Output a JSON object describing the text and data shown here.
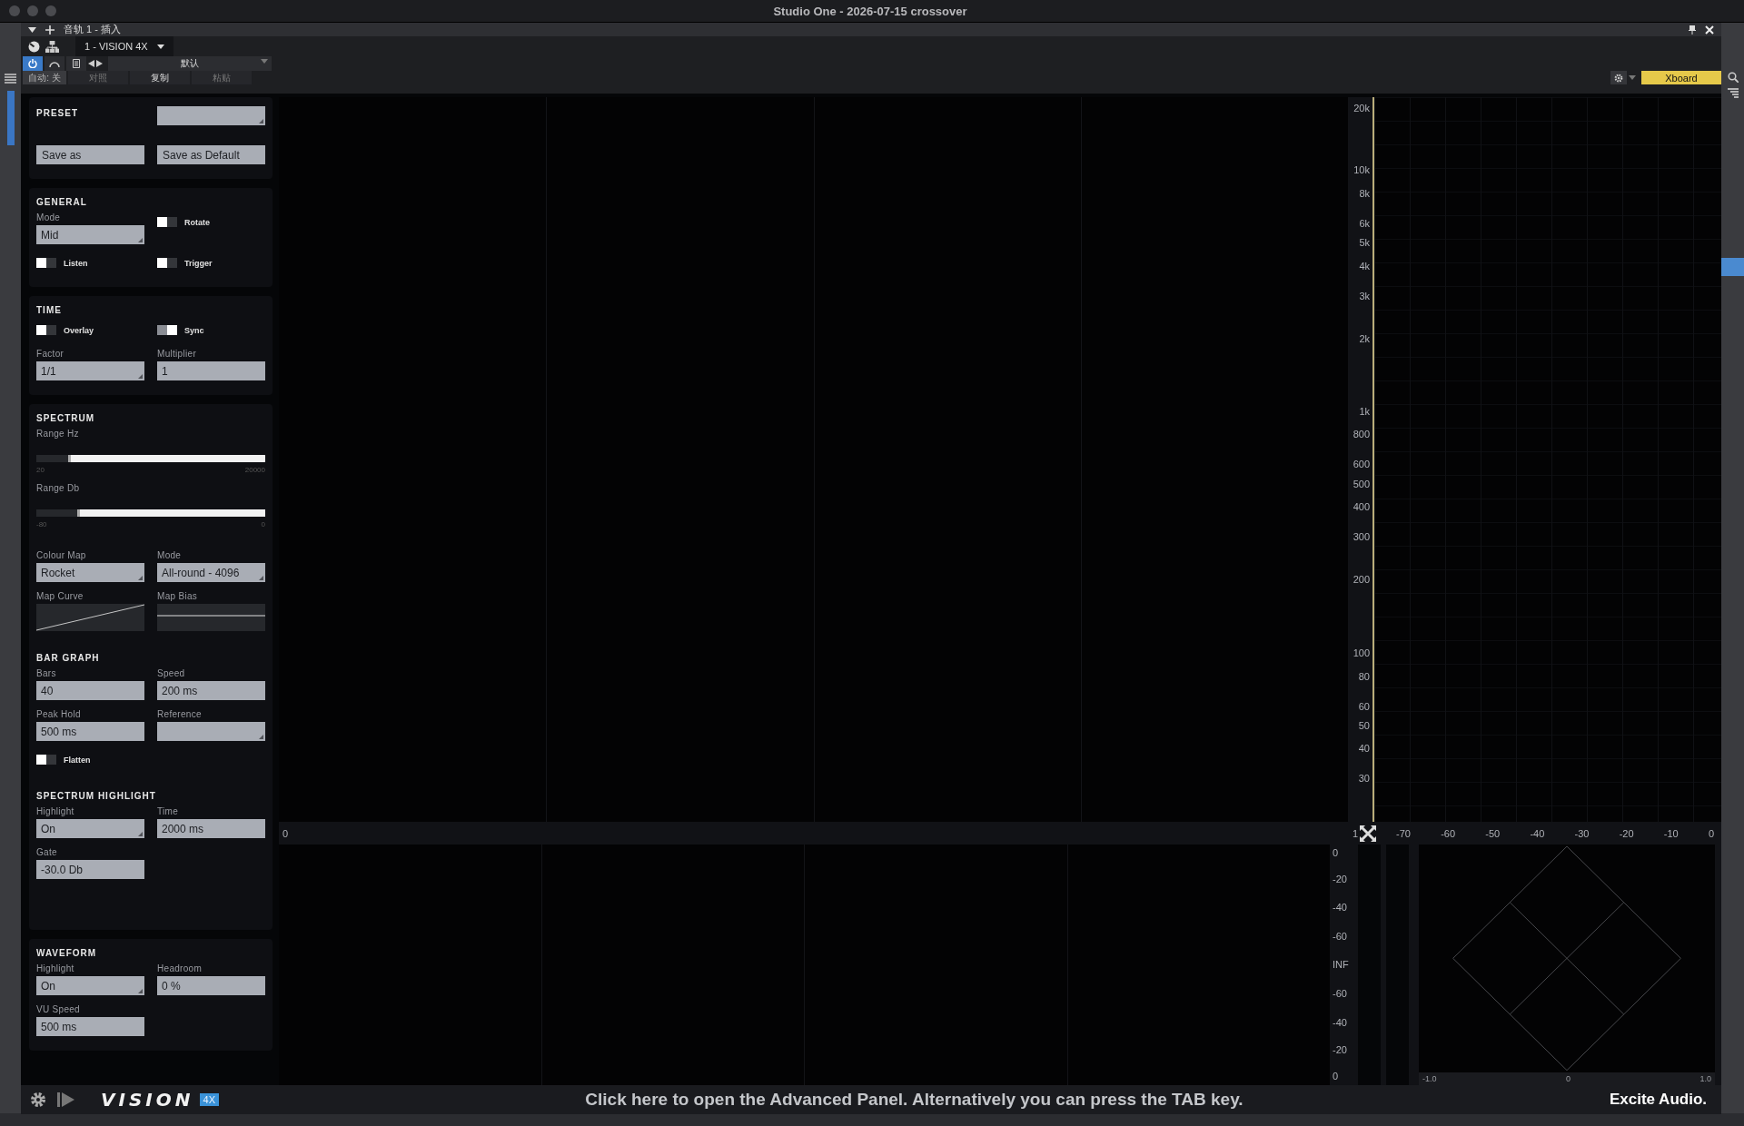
{
  "window": {
    "title": "Studio One - 2026-07-15 crossover"
  },
  "plugin_header": {
    "track": "音轨 1 - 插入",
    "plugin": "1 - VISION 4X",
    "preset": "默认",
    "power_on": true,
    "auto": "自动: 关",
    "compare": "对照",
    "copy": "复制",
    "paste": "粘贴",
    "xboard": "Xboard"
  },
  "cards": [
    {
      "groups": [
        {
          "items": [
            {
              "kind": "heading",
              "text": "PRESET"
            },
            {
              "kind": "field",
              "dropdown": true
            },
            {
              "kind": "button",
              "text": "Save as"
            },
            {
              "kind": "button",
              "text": "Save as Default"
            }
          ]
        }
      ]
    },
    {
      "groups": [
        {
          "title": "GENERAL",
          "items": [
            {
              "kind": "field",
              "label": "Mode",
              "value": "Mid",
              "dropdown": true
            },
            {
              "kind": "toggle",
              "label": "Rotate",
              "checked": false
            },
            {
              "kind": "toggle",
              "label": "Listen",
              "checked": false
            },
            {
              "kind": "toggle",
              "label": "Trigger",
              "checked": false
            }
          ]
        }
      ]
    },
    {
      "groups": [
        {
          "title": "TIME",
          "items": [
            {
              "kind": "toggle",
              "label": "Overlay",
              "checked": false
            },
            {
              "kind": "toggle",
              "label": "Sync",
              "checked": true
            },
            {
              "kind": "field",
              "label": "Factor",
              "value": "1/1",
              "dropdown": true
            },
            {
              "kind": "field",
              "label": "Multiplier",
              "value": "1",
              "dropdown": false
            }
          ]
        }
      ]
    },
    {
      "groups": [
        {
          "title": "SPECTRUM",
          "items": [
            {
              "kind": "slider",
              "label": "Range Hz",
              "level": 0.85,
              "min": "20",
              "max": "20000"
            },
            {
              "kind": "slider",
              "label": "Range Db",
              "level": 0.81,
              "min": "-80",
              "max": "0"
            }
          ]
        },
        {
          "items": [
            {
              "kind": "field",
              "label": "Colour Map",
              "value": "Rocket",
              "dropdown": true
            },
            {
              "kind": "field",
              "label": "Mode",
              "value": "All-round - 4096",
              "dropdown": true
            },
            {
              "kind": "curve_graph",
              "label": "Map Curve"
            },
            {
              "kind": "bias_graph",
              "label": "Map Bias"
            }
          ]
        },
        {
          "title": "BAR GRAPH",
          "items": [
            {
              "kind": "field",
              "label": "Bars",
              "value": "40",
              "dropdown": false
            },
            {
              "kind": "field",
              "label": "Speed",
              "value": "200 ms",
              "dropdown": false
            },
            {
              "kind": "field",
              "label": "Peak Hold",
              "value": "500 ms",
              "dropdown": false
            },
            {
              "kind": "field",
              "label": "Reference",
              "dropdown": true
            },
            {
              "kind": "toggle",
              "label": "Flatten",
              "checked": false
            }
          ]
        },
        {
          "title": "SPECTRUM HIGHLIGHT",
          "items": [
            {
              "kind": "field",
              "label": "Highlight",
              "value": "On",
              "dropdown": true
            },
            {
              "kind": "field",
              "label": "Time",
              "value": "2000 ms",
              "dropdown": false
            },
            {
              "kind": "field",
              "label": "Gate",
              "value": "-30.0 Db",
              "dropdown": false
            }
          ]
        }
      ]
    },
    {
      "groups": [
        {
          "title": "WAVEFORM",
          "items": [
            {
              "kind": "field",
              "label": "Highlight",
              "value": "On",
              "dropdown": true
            },
            {
              "kind": "field",
              "label": "Headroom",
              "value": "0 %",
              "dropdown": false
            },
            {
              "kind": "field",
              "label": "VU Speed",
              "value": "500 ms",
              "dropdown": false
            }
          ]
        }
      ]
    }
  ],
  "frequency_axis": [
    "20k",
    "10k",
    "8k",
    "6k",
    "5k",
    "4k",
    "3k",
    "2k",
    "1k",
    "800",
    "600",
    "500",
    "400",
    "300",
    "200",
    "100",
    "80",
    "60",
    "50",
    "40",
    "30"
  ],
  "middle_strip": {
    "start": "0",
    "end": "1",
    "db_scale": [
      "-70",
      "-60",
      "-50",
      "-40",
      "-30",
      "-20",
      "-10",
      "0"
    ]
  },
  "level_axis": [
    "0",
    "-20",
    "-40",
    "-60",
    "INF",
    "-60",
    "-40",
    "-20",
    "0"
  ],
  "vectorscope_scale": [
    "-1.0",
    "0",
    "1.0"
  ],
  "footer": {
    "logo": "VISION",
    "badge": "4X",
    "message": "Click here to open the Advanced Panel. Alternatively you can press the TAB key.",
    "brand": "Excite Audio."
  }
}
